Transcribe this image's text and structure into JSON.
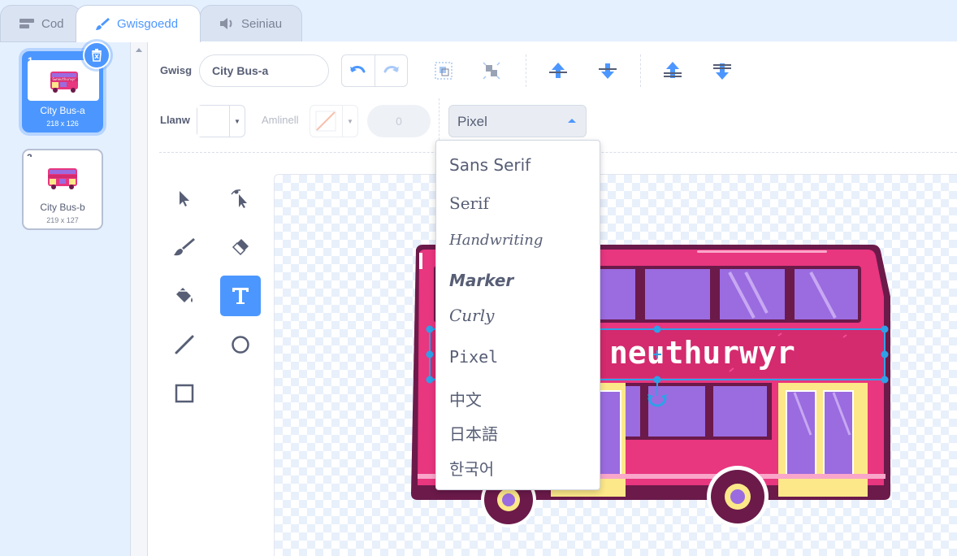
{
  "tabs": [
    {
      "label": "Cod",
      "icon": "code-icon"
    },
    {
      "label": "Gwisgoedd",
      "icon": "brush-icon"
    },
    {
      "label": "Seiniau",
      "icon": "speaker-icon"
    }
  ],
  "costumes": [
    {
      "number": "1",
      "name": "City Bus-a",
      "size": "218 x 126",
      "thumb_text": "Gwneuthurwyr"
    },
    {
      "number": "2",
      "name": "City Bus-b",
      "size": "219 x 127"
    }
  ],
  "toolbar": {
    "costume_label": "Gwisg",
    "costume_name": "City Bus-a",
    "fill_label": "Llanw",
    "outline_label": "Amlinell",
    "outline_width": "0",
    "font_selected": "Pixel"
  },
  "font_menu": {
    "options": [
      "Sans Serif",
      "Serif",
      "Handwriting",
      "Marker",
      "Curly",
      "Pixel",
      "中文",
      "日本語",
      "한국어"
    ]
  },
  "canvas": {
    "text_object": "Gwneuthurwyr",
    "visible_text": "neuthurwyr"
  },
  "colors": {
    "accent": "#4c97ff",
    "bus_body": "#e8367f",
    "bus_roof_dark": "#6b1a4a",
    "window": "#9b6be0",
    "door": "#fce889"
  }
}
